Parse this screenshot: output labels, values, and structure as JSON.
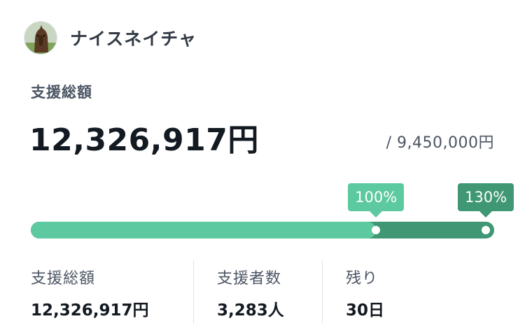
{
  "author": {
    "name": "ナイスネイチャ",
    "avatar_icon": "horse-avatar-icon"
  },
  "total": {
    "label": "支援総額",
    "amount": "12,326,917円",
    "goal": "/ 9,450,000円"
  },
  "progress": {
    "fraction_of_bar": 0.745,
    "markers": [
      {
        "label": "100%",
        "position": 0.745,
        "color": "#5cc9a0"
      },
      {
        "label": "130%",
        "position": 0.982,
        "color": "#3f9774"
      }
    ],
    "fill_color": "#5cc9a0",
    "track_color": "#3f9774"
  },
  "stats": [
    {
      "label": "支援総額",
      "value": "12,326,917円"
    },
    {
      "label": "支援者数",
      "value": "3,283人"
    },
    {
      "label": "残り",
      "value": "30日"
    }
  ]
}
